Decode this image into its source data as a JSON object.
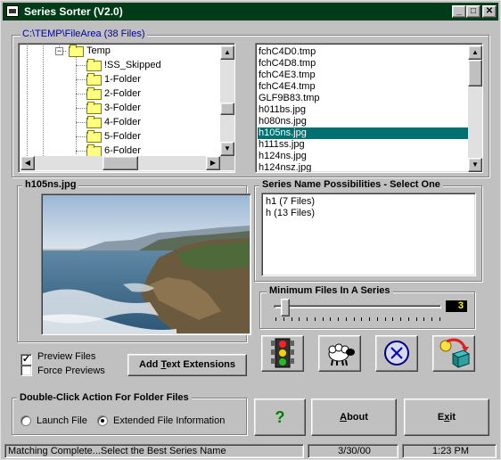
{
  "window": {
    "title": "Series Sorter (V2.0)",
    "minimize": "_",
    "maximize": "□",
    "close": "✕"
  },
  "folder_path": "C:\\TEMP\\FileArea (38 Files)",
  "tree": {
    "root": "Temp",
    "children": [
      "!SS_Skipped",
      "1-Folder",
      "2-Folder",
      "3-Folder",
      "4-Folder",
      "5-Folder",
      "6-Folder"
    ]
  },
  "files": {
    "items": [
      "fchC4D0.tmp",
      "fchC4D8.tmp",
      "fchC4E3.tmp",
      "fchC4E4.tmp",
      "GLF9B83.tmp",
      "h011bs.jpg",
      "h080ns.jpg",
      "h105ns.jpg",
      "h111ss.jpg",
      "h124ns.jpg",
      "h124nsz.jpg"
    ],
    "selected": "h105ns.jpg"
  },
  "preview": {
    "title": "h105ns.jpg"
  },
  "series": {
    "title": "Series Name Possibilities - Select One",
    "items": [
      "h1 (7 Files)",
      "h (13 Files)"
    ]
  },
  "min_files": {
    "title": "Minimum Files In A Series",
    "value": "3",
    "level_fraction": 0.06
  },
  "tool_buttons": [
    "traffic-light-icon",
    "sheep-icon",
    "cancel-x-icon",
    "move-files-icon"
  ],
  "options": {
    "preview_files_label": "Preview Files",
    "preview_files_checked": true,
    "force_previews_label": "Force Previews",
    "force_previews_checked": false,
    "add_ext_label_pre": "Add ",
    "add_ext_label_u": "T",
    "add_ext_label_post": "ext Extensions"
  },
  "double_click": {
    "title": "Double-Click Action For Folder Files",
    "launch_label": "Launch File",
    "extended_label": "Extended File Information",
    "selected": "extended"
  },
  "buttons": {
    "help_label": "?",
    "about_u": "A",
    "about_rest": "bout",
    "exit_pre": "E",
    "exit_u": "x",
    "exit_post": "it"
  },
  "status": {
    "message": "Matching Complete...Select the Best Series Name",
    "date": "3/30/00",
    "time": "1:23 PM"
  },
  "colors": {
    "titlebar": "#003c18",
    "selection": "#007070",
    "path_text": "#0000a0",
    "readout_text": "#ffff00"
  }
}
